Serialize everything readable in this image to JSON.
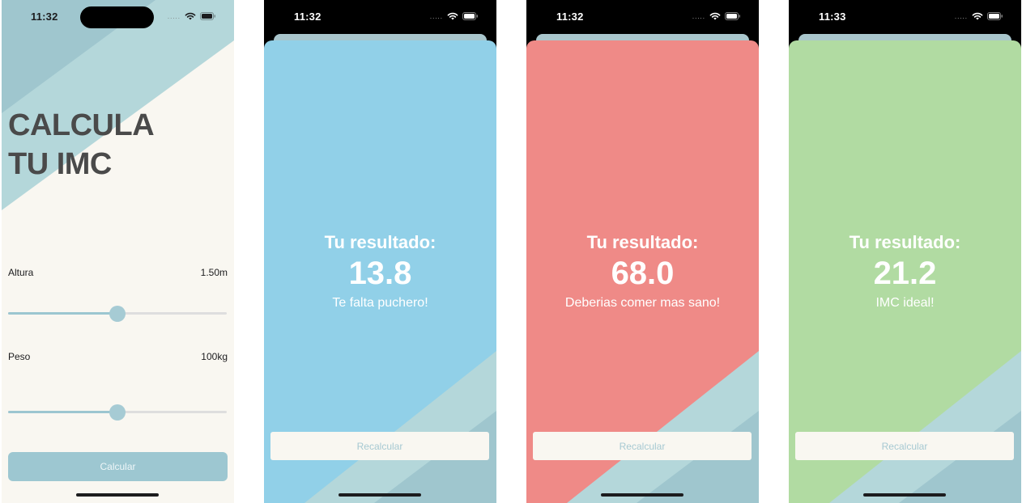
{
  "colors": {
    "cream": "#f9f7f1",
    "light_teal": "#b4d7da",
    "mid_teal": "#9fc6ce",
    "title_gray": "#4a4a4a",
    "blue": "#91d0e8",
    "red": "#ef8a87",
    "green": "#b1dba2"
  },
  "screens": [
    {
      "status": {
        "time": "11:32",
        "signal": ".....",
        "wifi_icon": "wifi-icon",
        "battery_icon": "battery-icon"
      },
      "title_line1": "CALCULA",
      "title_line2": "TU IMC",
      "height": {
        "label": "Altura",
        "value": "1.50m",
        "slider_fraction": 0.5
      },
      "weight": {
        "label": "Peso",
        "value": "100kg",
        "slider_fraction": 0.5
      },
      "calculate_label": "Calcular"
    },
    {
      "status": {
        "time": "11:32",
        "signal": "....."
      },
      "heading": "Tu resultado:",
      "value": "13.8",
      "message": "Te falta puchero!",
      "recalculate_label": "Recalcular",
      "color": "#91d0e8"
    },
    {
      "status": {
        "time": "11:32",
        "signal": "....."
      },
      "heading": "Tu resultado:",
      "value": "68.0",
      "message": "Deberias comer mas sano!",
      "recalculate_label": "Recalcular",
      "color": "#ef8a87"
    },
    {
      "status": {
        "time": "11:33",
        "signal": "....."
      },
      "heading": "Tu resultado:",
      "value": "21.2",
      "message": "IMC ideal!",
      "recalculate_label": "Recalcular",
      "color": "#b1dba2"
    }
  ]
}
